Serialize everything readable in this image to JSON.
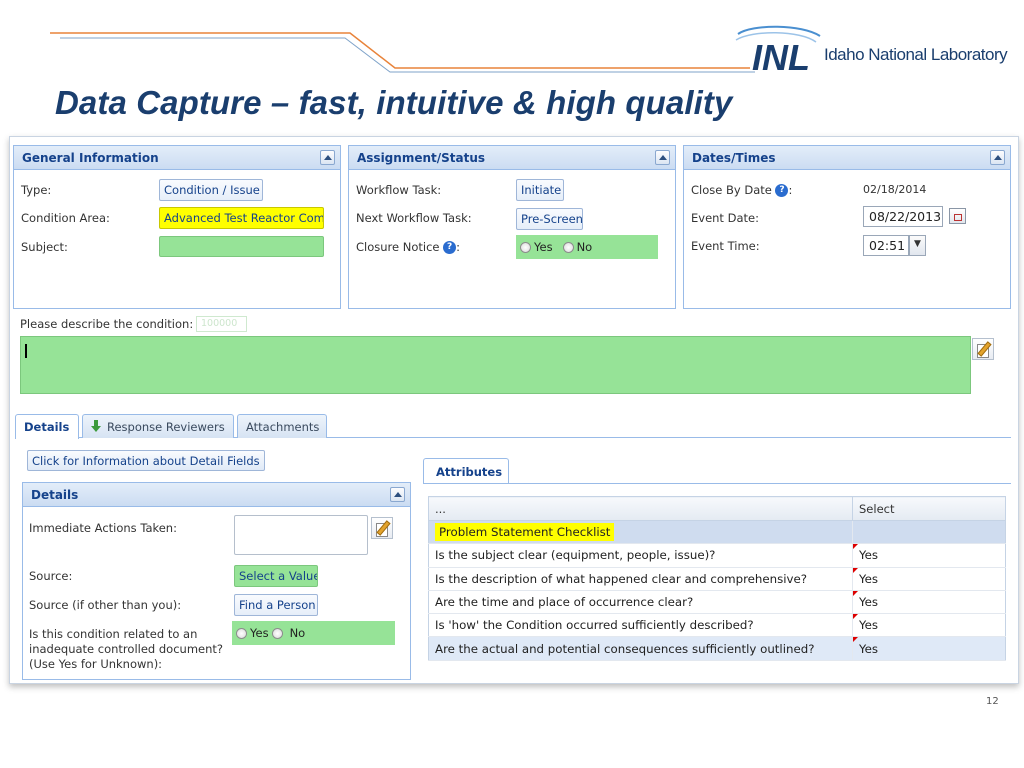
{
  "slide": {
    "title": "Data Capture – fast, intuitive & high quality",
    "logo_mark": "INL",
    "logo_text": "Idaho National Laboratory",
    "page_number": "12"
  },
  "general": {
    "header": "General Information",
    "type_label": "Type:",
    "type_value": "Condition / Issue",
    "area_label": "Condition Area:",
    "area_value": "Advanced Test Reactor Com",
    "subject_label": "Subject:",
    "subject_value": ""
  },
  "assignment": {
    "header": "Assignment/Status",
    "task_label": "Workflow Task:",
    "task_value": "Initiate",
    "next_label": "Next Workflow Task:",
    "next_value": "Pre-Screen",
    "closure_label": "Closure Notice",
    "closure_colon": ":",
    "yes": "Yes",
    "no": "No"
  },
  "dates": {
    "header": "Dates/Times",
    "close_label": "Close By Date",
    "close_colon": ":",
    "close_value": "02/18/2014",
    "event_date_label": "Event Date:",
    "event_date_value": "08/22/2013",
    "event_time_label": "Event Time:",
    "event_time_value": "02:51"
  },
  "describe": {
    "label": "Please describe the condition:",
    "counter": "100000"
  },
  "tabs": [
    "Details",
    "Response Reviewers",
    "Attachments"
  ],
  "info_button": "Click for Information about Detail Fields",
  "details": {
    "header": "Details",
    "actions_label": "Immediate Actions Taken:",
    "source_label": "Source:",
    "source_value": "Select a Value",
    "source_other_label": "Source (if other than you):",
    "source_other_value": "Find a Person",
    "related_label_1": "Is this condition related to an",
    "related_label_2": "inadequate controlled document?",
    "related_label_3": "(Use Yes for Unknown):",
    "yes": "Yes",
    "no": "No"
  },
  "attributes": {
    "tab": "Attributes",
    "col1": "...",
    "col2": "Select",
    "group": "Problem Statement Checklist",
    "rows": [
      {
        "q": "Is the subject clear (equipment, people, issue)?",
        "a": "Yes"
      },
      {
        "q": "Is the description of what happened clear and comprehensive?",
        "a": "Yes"
      },
      {
        "q": "Are the time and place of occurrence clear?",
        "a": "Yes"
      },
      {
        "q": "Is 'how' the Condition occurred sufficiently described?",
        "a": "Yes"
      },
      {
        "q": "Are the actual and potential consequences sufficiently outlined?",
        "a": "Yes"
      }
    ]
  }
}
